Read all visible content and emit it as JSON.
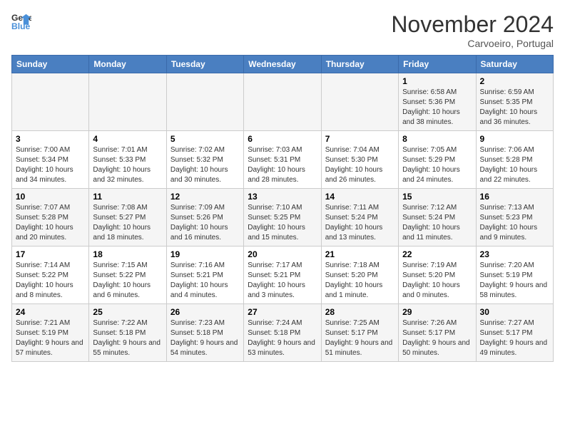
{
  "logo": {
    "general": "General",
    "blue": "Blue"
  },
  "title": "November 2024",
  "subtitle": "Carvoeiro, Portugal",
  "days_of_week": [
    "Sunday",
    "Monday",
    "Tuesday",
    "Wednesday",
    "Thursday",
    "Friday",
    "Saturday"
  ],
  "weeks": [
    [
      {
        "day": "",
        "info": ""
      },
      {
        "day": "",
        "info": ""
      },
      {
        "day": "",
        "info": ""
      },
      {
        "day": "",
        "info": ""
      },
      {
        "day": "",
        "info": ""
      },
      {
        "day": "1",
        "info": "Sunrise: 6:58 AM\nSunset: 5:36 PM\nDaylight: 10 hours and 38 minutes."
      },
      {
        "day": "2",
        "info": "Sunrise: 6:59 AM\nSunset: 5:35 PM\nDaylight: 10 hours and 36 minutes."
      }
    ],
    [
      {
        "day": "3",
        "info": "Sunrise: 7:00 AM\nSunset: 5:34 PM\nDaylight: 10 hours and 34 minutes."
      },
      {
        "day": "4",
        "info": "Sunrise: 7:01 AM\nSunset: 5:33 PM\nDaylight: 10 hours and 32 minutes."
      },
      {
        "day": "5",
        "info": "Sunrise: 7:02 AM\nSunset: 5:32 PM\nDaylight: 10 hours and 30 minutes."
      },
      {
        "day": "6",
        "info": "Sunrise: 7:03 AM\nSunset: 5:31 PM\nDaylight: 10 hours and 28 minutes."
      },
      {
        "day": "7",
        "info": "Sunrise: 7:04 AM\nSunset: 5:30 PM\nDaylight: 10 hours and 26 minutes."
      },
      {
        "day": "8",
        "info": "Sunrise: 7:05 AM\nSunset: 5:29 PM\nDaylight: 10 hours and 24 minutes."
      },
      {
        "day": "9",
        "info": "Sunrise: 7:06 AM\nSunset: 5:28 PM\nDaylight: 10 hours and 22 minutes."
      }
    ],
    [
      {
        "day": "10",
        "info": "Sunrise: 7:07 AM\nSunset: 5:28 PM\nDaylight: 10 hours and 20 minutes."
      },
      {
        "day": "11",
        "info": "Sunrise: 7:08 AM\nSunset: 5:27 PM\nDaylight: 10 hours and 18 minutes."
      },
      {
        "day": "12",
        "info": "Sunrise: 7:09 AM\nSunset: 5:26 PM\nDaylight: 10 hours and 16 minutes."
      },
      {
        "day": "13",
        "info": "Sunrise: 7:10 AM\nSunset: 5:25 PM\nDaylight: 10 hours and 15 minutes."
      },
      {
        "day": "14",
        "info": "Sunrise: 7:11 AM\nSunset: 5:24 PM\nDaylight: 10 hours and 13 minutes."
      },
      {
        "day": "15",
        "info": "Sunrise: 7:12 AM\nSunset: 5:24 PM\nDaylight: 10 hours and 11 minutes."
      },
      {
        "day": "16",
        "info": "Sunrise: 7:13 AM\nSunset: 5:23 PM\nDaylight: 10 hours and 9 minutes."
      }
    ],
    [
      {
        "day": "17",
        "info": "Sunrise: 7:14 AM\nSunset: 5:22 PM\nDaylight: 10 hours and 8 minutes."
      },
      {
        "day": "18",
        "info": "Sunrise: 7:15 AM\nSunset: 5:22 PM\nDaylight: 10 hours and 6 minutes."
      },
      {
        "day": "19",
        "info": "Sunrise: 7:16 AM\nSunset: 5:21 PM\nDaylight: 10 hours and 4 minutes."
      },
      {
        "day": "20",
        "info": "Sunrise: 7:17 AM\nSunset: 5:21 PM\nDaylight: 10 hours and 3 minutes."
      },
      {
        "day": "21",
        "info": "Sunrise: 7:18 AM\nSunset: 5:20 PM\nDaylight: 10 hours and 1 minute."
      },
      {
        "day": "22",
        "info": "Sunrise: 7:19 AM\nSunset: 5:20 PM\nDaylight: 10 hours and 0 minutes."
      },
      {
        "day": "23",
        "info": "Sunrise: 7:20 AM\nSunset: 5:19 PM\nDaylight: 9 hours and 58 minutes."
      }
    ],
    [
      {
        "day": "24",
        "info": "Sunrise: 7:21 AM\nSunset: 5:19 PM\nDaylight: 9 hours and 57 minutes."
      },
      {
        "day": "25",
        "info": "Sunrise: 7:22 AM\nSunset: 5:18 PM\nDaylight: 9 hours and 55 minutes."
      },
      {
        "day": "26",
        "info": "Sunrise: 7:23 AM\nSunset: 5:18 PM\nDaylight: 9 hours and 54 minutes."
      },
      {
        "day": "27",
        "info": "Sunrise: 7:24 AM\nSunset: 5:18 PM\nDaylight: 9 hours and 53 minutes."
      },
      {
        "day": "28",
        "info": "Sunrise: 7:25 AM\nSunset: 5:17 PM\nDaylight: 9 hours and 51 minutes."
      },
      {
        "day": "29",
        "info": "Sunrise: 7:26 AM\nSunset: 5:17 PM\nDaylight: 9 hours and 50 minutes."
      },
      {
        "day": "30",
        "info": "Sunrise: 7:27 AM\nSunset: 5:17 PM\nDaylight: 9 hours and 49 minutes."
      }
    ]
  ]
}
